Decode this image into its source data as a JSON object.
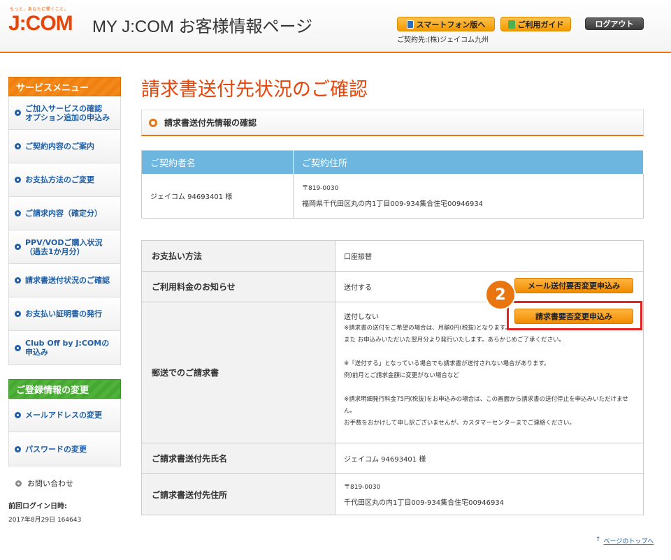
{
  "header": {
    "tagline": "もっと、あなたに響くこと。",
    "logo": "J:COM",
    "site_title": "MY J:COM お客様情報ページ",
    "smartphone_btn": "スマートフォン版へ",
    "guide_btn": "ご利用ガイド",
    "logout_btn": "ログアウト",
    "contract_info": "ご契約先:(株)ジェイコム九州"
  },
  "sidebar": {
    "service_menu_title": "サービスメニュー",
    "service_items": [
      "ご加入サービスの確認\nオプション追加の申込み",
      "ご契約内容のご案内",
      "お支払方法のご変更",
      "ご請求内容（確定分）",
      "PPV/VODご購入状況\n（過去1か月分）",
      "請求書送付状況のご確認",
      "お支払い証明書の発行",
      "Club Off by J:COMの\n申込み"
    ],
    "registration_title": "ご登録情報の変更",
    "registration_items": [
      "メールアドレスの変更",
      "パスワードの変更"
    ],
    "inquiry": "お問い合わせ",
    "last_login_label": "前回ログイン日時:",
    "last_login_value": "2017年8月29日 164643"
  },
  "main": {
    "page_title": "請求書送付先状況のご確認",
    "section_title": "請求書送付先情報の確認",
    "contract_table": {
      "headers": [
        "ご契約者名",
        "ご契約住所"
      ],
      "name": "ジェイコム 94693401 様",
      "postal": "〒819-0030",
      "address": "福岡県千代田区丸の内1丁目009-934集合住宅00946934"
    },
    "detail": {
      "payment_label": "お支払い方法",
      "payment_value": "口座振替",
      "notice_label": "ご利用料金のお知らせ",
      "notice_value": "送付する",
      "mail_change_btn": "メール送付要否変更申込み",
      "postal_label": "郵送でのご請求書",
      "postal_value": "送付しない",
      "invoice_change_btn": "請求書要否変更申込み",
      "notes": [
        "※請求書の送付をご希望の場合は、月額0円(税抜)となります。",
        "また お申込みいただいた翌月分より発行いたします。あらかじめご了承ください。",
        "",
        "※「送付する」となっている場合でも請求書が送付されない場合があります。",
        "例)前月とご請求金額に変更がない場合など",
        "",
        "※請求明細発行料金75円(税抜)をお申込みの場合は、この画面から請求書の送付停止を申込みいただけませ",
        "ん。",
        "お手数をおかけして申し訳ございませんが、カスタマーセンターまでご連絡ください。"
      ],
      "recipient_name_label": "ご請求書送付先氏名",
      "recipient_name_value": "ジェイコム 94693401 様",
      "recipient_address_label": "ご請求書送付先住所",
      "recipient_postal": "〒819-0030",
      "recipient_address": "千代田区丸の内1丁目009-934集合住宅00946934"
    },
    "step_number": "2",
    "page_top": "ページのトップへ",
    "page_top_arrow": "↑"
  },
  "colors": {
    "accent": "#e8450a",
    "orange": "#f08a00",
    "blue_header": "#6cb6df",
    "link": "#1e5fa8",
    "highlight": "#e52222"
  }
}
